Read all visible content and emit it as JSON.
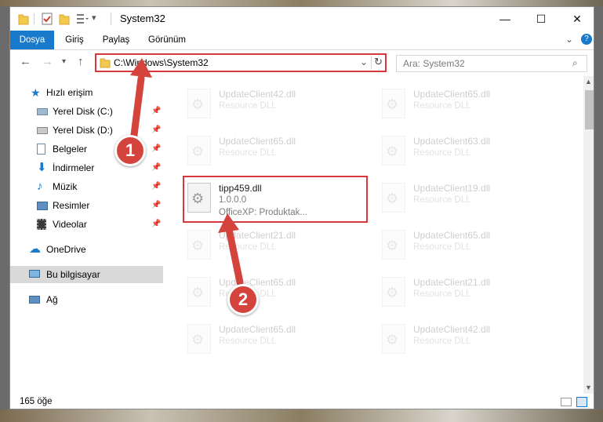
{
  "window": {
    "title": "System32",
    "controls": {
      "minimize": "—",
      "maximize": "☐",
      "close": "✕"
    }
  },
  "ribbon": {
    "tabs": [
      "Dosya",
      "Giriş",
      "Paylaş",
      "Görünüm"
    ],
    "expand_icon": "chevron-down-icon",
    "help_icon": "help-icon"
  },
  "address": {
    "path": "C:\\Windows\\System32",
    "search_placeholder": "Ara: System32"
  },
  "sidebar": {
    "items": [
      {
        "label": "Hızlı erişim",
        "icon": "star-icon",
        "pinned": false
      },
      {
        "label": "Yerel Disk (C:)",
        "icon": "drive-icon",
        "pinned": true
      },
      {
        "label": "Yerel Disk (D:)",
        "icon": "drive-icon",
        "pinned": true
      },
      {
        "label": "Belgeler",
        "icon": "documents-icon",
        "pinned": true
      },
      {
        "label": "İndirmeler",
        "icon": "download-icon",
        "pinned": true
      },
      {
        "label": "Müzik",
        "icon": "music-icon",
        "pinned": true
      },
      {
        "label": "Resimler",
        "icon": "pictures-icon",
        "pinned": true
      },
      {
        "label": "Videolar",
        "icon": "videos-icon",
        "pinned": true
      },
      {
        "label": "OneDrive",
        "icon": "cloud-icon",
        "pinned": false
      },
      {
        "label": "Bu bilgisayar",
        "icon": "computer-icon",
        "pinned": false
      },
      {
        "label": "Ağ",
        "icon": "network-icon",
        "pinned": false
      }
    ]
  },
  "files": {
    "left": [
      {
        "name": "UpdateClient42.dll",
        "desc": "Resource DLL"
      },
      {
        "name": "UpdateClient65.dll",
        "desc": "Resource DLL"
      },
      {
        "name": "tipp459.dll",
        "version": "1.0.0.0",
        "desc": "OfficeXP: Produktak..."
      },
      {
        "name": "UpdateClient21.dll",
        "desc": "Resource DLL"
      },
      {
        "name": "UpdateClient65.dll",
        "desc": "Resource DLL"
      },
      {
        "name": "UpdateClient65.dll",
        "desc": "Resource DLL"
      }
    ],
    "right": [
      {
        "name": "UpdateClient65.dll",
        "desc": "Resource DLL"
      },
      {
        "name": "UpdateClient63.dll",
        "desc": "Resource DLL"
      },
      {
        "name": "UpdateClient19.dll",
        "desc": "Resource DLL"
      },
      {
        "name": "UpdateClient65.dll",
        "desc": "Resource DLL"
      },
      {
        "name": "UpdateClient21.dll",
        "desc": "Resource DLL"
      },
      {
        "name": "UpdateClient42.dll",
        "desc": "Resource DLL"
      }
    ]
  },
  "status": {
    "count": "165 öğe"
  },
  "annotations": {
    "step1": "1",
    "step2": "2"
  },
  "colors": {
    "accent": "#1979ca",
    "highlight": "#d9383b",
    "arrow": "#d5433d"
  }
}
